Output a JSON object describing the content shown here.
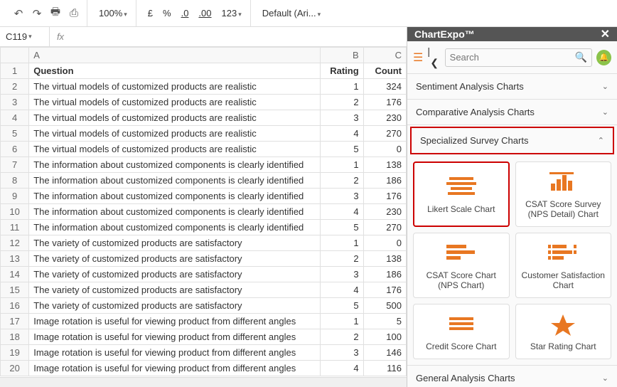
{
  "toolbar": {
    "zoom": "100%",
    "currency": "£",
    "percent": "%",
    "dec_dec": ".0",
    "dec_inc": ".00",
    "num_format": "123",
    "font": "Default (Ari..."
  },
  "cell_ref": "C119",
  "fx_label": "fx",
  "columns": [
    "A",
    "B",
    "C"
  ],
  "header": {
    "a": "Question",
    "b": "Rating",
    "c": "Count"
  },
  "rows": [
    {
      "n": "2",
      "a": "The virtual models of customized products are realistic",
      "b": "1",
      "c": "324"
    },
    {
      "n": "3",
      "a": "The virtual models of customized products are realistic",
      "b": "2",
      "c": "176"
    },
    {
      "n": "4",
      "a": "The virtual models of customized products are realistic",
      "b": "3",
      "c": "230"
    },
    {
      "n": "5",
      "a": "The virtual models of customized products are realistic",
      "b": "4",
      "c": "270"
    },
    {
      "n": "6",
      "a": "The virtual models of customized products are realistic",
      "b": "5",
      "c": "0"
    },
    {
      "n": "7",
      "a": "The information about customized components is clearly identified",
      "b": "1",
      "c": "138"
    },
    {
      "n": "8",
      "a": "The information about customized components is clearly identified",
      "b": "2",
      "c": "186"
    },
    {
      "n": "9",
      "a": "The information about customized components is clearly identified",
      "b": "3",
      "c": "176"
    },
    {
      "n": "10",
      "a": "The information about customized components is clearly identified",
      "b": "4",
      "c": "230"
    },
    {
      "n": "11",
      "a": "The information about customized components is clearly identified",
      "b": "5",
      "c": "270"
    },
    {
      "n": "12",
      "a": "The variety of customized products are satisfactory",
      "b": "1",
      "c": "0"
    },
    {
      "n": "13",
      "a": "The variety of customized products are satisfactory",
      "b": "2",
      "c": "138"
    },
    {
      "n": "14",
      "a": "The variety of customized products are satisfactory",
      "b": "3",
      "c": "186"
    },
    {
      "n": "15",
      "a": "The variety of customized products are satisfactory",
      "b": "4",
      "c": "176"
    },
    {
      "n": "16",
      "a": "The variety of customized products are satisfactory",
      "b": "5",
      "c": "500"
    },
    {
      "n": "17",
      "a": "Image rotation is useful for viewing product from different angles",
      "b": "1",
      "c": "5"
    },
    {
      "n": "18",
      "a": "Image rotation is useful for viewing product from different angles",
      "b": "2",
      "c": "100"
    },
    {
      "n": "19",
      "a": "Image rotation is useful for viewing product from different angles",
      "b": "3",
      "c": "146"
    },
    {
      "n": "20",
      "a": "Image rotation is useful for viewing product from different angles",
      "b": "4",
      "c": "116"
    }
  ],
  "sidebar": {
    "title": "ChartExpo™",
    "search_placeholder": "Search",
    "sections": {
      "sentiment": "Sentiment Analysis Charts",
      "comparative": "Comparative Analysis Charts",
      "specialized": "Specialized Survey Charts",
      "general": "General Analysis Charts"
    },
    "charts": {
      "likert": "Likert Scale Chart",
      "csat_nps_detail": "CSAT Score Survey (NPS Detail) Chart",
      "csat_nps": "CSAT Score Chart (NPS Chart)",
      "customer_sat": "Customer Satisfaction Chart",
      "credit": "Credit Score Chart",
      "star": "Star Rating Chart"
    }
  }
}
